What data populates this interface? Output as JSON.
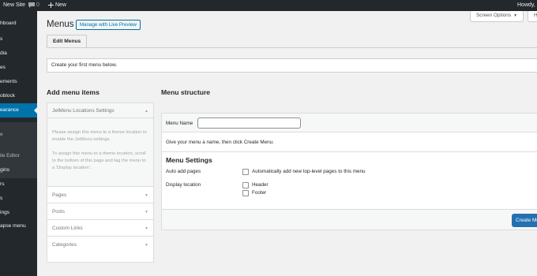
{
  "adminbar": {
    "site_name": "New Site",
    "comments_count": "0",
    "new_label": "New",
    "howdy": "Howdy, a"
  },
  "sidebar": {
    "items": [
      {
        "label": "hboard"
      },
      {
        "label": "s"
      },
      {
        "label": "dia"
      },
      {
        "label": "es"
      },
      {
        "label": "ements"
      },
      {
        "label": "oblock"
      },
      {
        "label": "earance"
      },
      {
        "label": "gins"
      },
      {
        "label": "rs"
      },
      {
        "label": "s"
      },
      {
        "label": "ings"
      },
      {
        "label": "apse menu"
      }
    ],
    "submenu": [
      {
        "label": "e"
      },
      {
        "label": ""
      },
      {
        "label": "ile Editor"
      }
    ]
  },
  "header": {
    "title": "Menus",
    "live_preview": "Manage with Live Preview",
    "screen_options": "Screen Options",
    "help": "He"
  },
  "tabs": [
    {
      "label": "Edit Menus"
    }
  ],
  "notice": "Create your first menu below.",
  "left": {
    "heading": "Add menu items",
    "jetmenu_title": "JetMenu Locations Settings",
    "jetmenu_text1": "Please assign this menu to a theme location to enable the JetMenu settings.",
    "jetmenu_text2": "To assign this menu to a theme location, scroll to the bottom of this page and tag the menu to a 'Display location'.",
    "sections": [
      {
        "label": "Pages"
      },
      {
        "label": "Posts"
      },
      {
        "label": "Custom Links"
      },
      {
        "label": "Categories"
      }
    ]
  },
  "right": {
    "heading": "Menu structure",
    "menu_name_label": "Menu Name",
    "menu_name_value": "",
    "hint": "Give your menu a name, then click Create Menu.",
    "settings_heading": "Menu Settings",
    "auto_add_label": "Auto add pages",
    "auto_add_option": "Automatically add new top-level pages to this menu",
    "display_location_label": "Display location",
    "locations": [
      {
        "label": "Header"
      },
      {
        "label": "Footer"
      }
    ],
    "create_button": "Create Menu"
  }
}
